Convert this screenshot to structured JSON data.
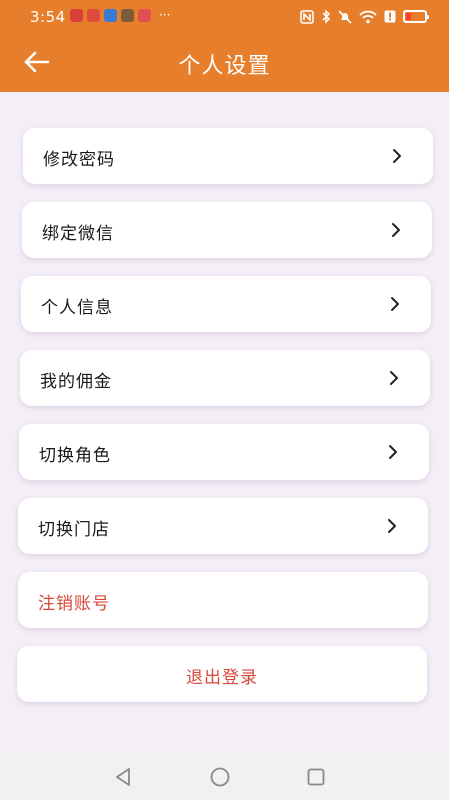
{
  "status_bar": {
    "time": "3:54",
    "more": "···",
    "app_icons": [
      {
        "name": "app-icon-1",
        "color": "#d9403a"
      },
      {
        "name": "app-icon-2",
        "color": "#e04b3e"
      },
      {
        "name": "app-icon-3",
        "color": "#3a7bd5"
      },
      {
        "name": "app-icon-4",
        "color": "#7a5b3a"
      },
      {
        "name": "app-icon-5",
        "color": "#e05050"
      }
    ],
    "right_icons": [
      "nfc-icon",
      "bluetooth-icon",
      "mute-icon",
      "wifi-icon",
      "alert-icon",
      "battery-icon"
    ]
  },
  "header": {
    "title": "个人设置",
    "back_icon": "arrow-left-icon",
    "color": "#e67e2b"
  },
  "menu": {
    "items": [
      {
        "label": "修改密码"
      },
      {
        "label": "绑定微信"
      },
      {
        "label": "个人信息"
      },
      {
        "label": "我的佣金"
      },
      {
        "label": "切换角色"
      },
      {
        "label": "切换门店"
      }
    ],
    "cancel_account": "注销账号",
    "logout": "退出登录",
    "danger_color": "#d8473a"
  },
  "nav": {
    "buttons": [
      "back-triangle-icon",
      "home-circle-icon",
      "recents-square-icon"
    ]
  }
}
